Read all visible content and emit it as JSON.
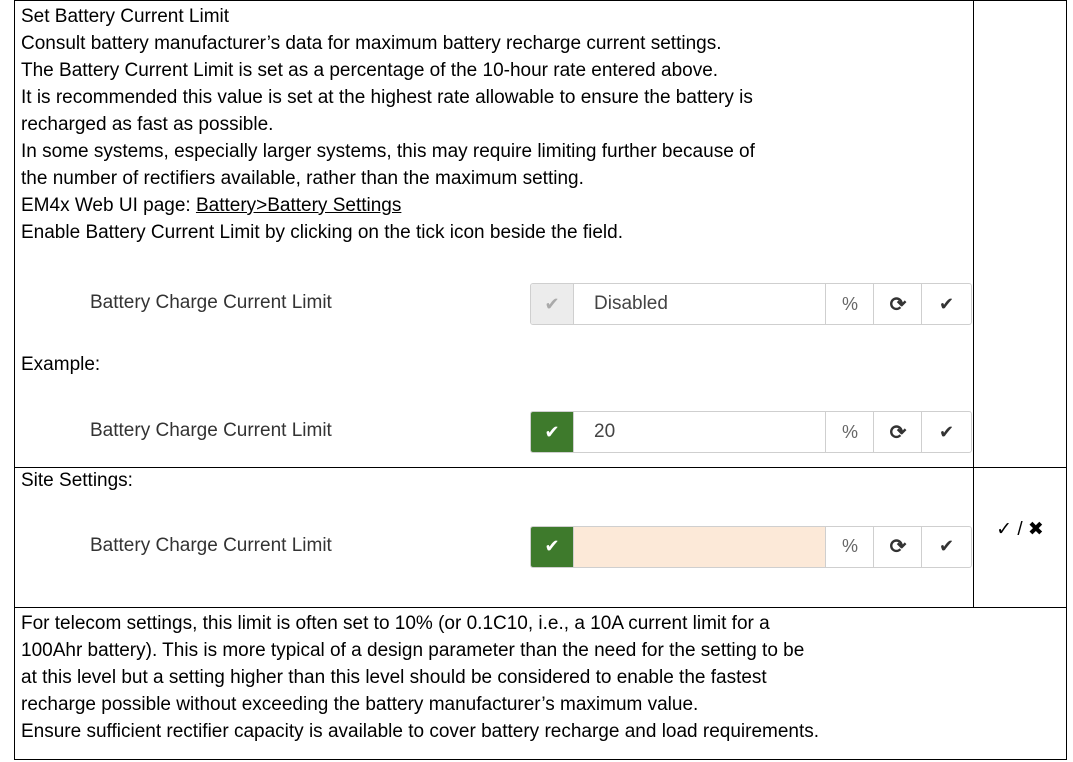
{
  "section1": {
    "lines": [
      "Set Battery Current Limit",
      "Consult battery manufacturer’s data for maximum battery recharge current settings.",
      "The Battery Current Limit is set as a percentage of the 10-hour rate entered above.",
      "It is recommended this value is set at the highest rate allowable to ensure the battery is",
      "recharged as fast as possible.",
      "In some systems, especially larger systems, this may require limiting further because of",
      "the number of rectifiers available, rather than the maximum setting."
    ],
    "page_prefix": "EM4x Web UI page: ",
    "page_link": "Battery>Battery Settings",
    "enable_line": "Enable Battery Current Limit by clicking on the tick icon beside the field.",
    "field1": {
      "label": "Battery Charge Current Limit",
      "value": "Disabled",
      "unit": "%",
      "toggle_icon": "check-icon",
      "refresh_icon": "refresh-icon",
      "save_icon": "check-icon"
    },
    "example_label": "Example:",
    "field2": {
      "label": "Battery Charge Current Limit",
      "value": "20",
      "unit": "%"
    }
  },
  "section2": {
    "title": "Site Settings:",
    "field": {
      "label": "Battery Charge Current Limit",
      "value": "",
      "unit": "%"
    },
    "side_check": "✓ / ✖"
  },
  "section3": {
    "lines": [
      "For telecom settings, this limit is often set to 10% (or 0.1C10, i.e., a 10A current limit for a",
      "100Ahr battery). This is more typical of a design parameter than the need for the setting to be",
      "at this level but a setting higher than this level should be considered to enable the fastest",
      "recharge possible without exceeding the battery manufacturer’s maximum value.",
      "Ensure sufficient rectifier capacity is available to cover battery recharge and load requirements."
    ]
  },
  "colors": {
    "toggle_on": "#3e7a2c",
    "site_value_bg": "#fce9d8"
  }
}
